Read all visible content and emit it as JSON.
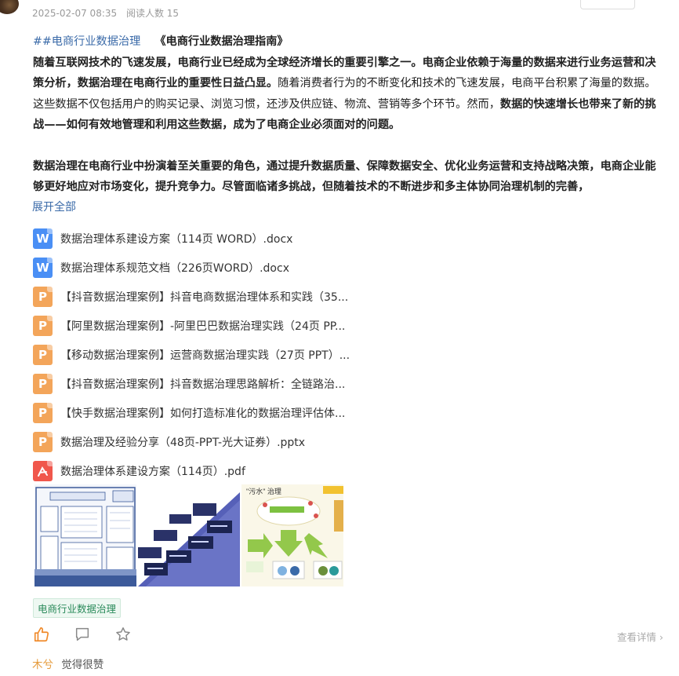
{
  "meta": {
    "date": "2025-02-07 08:35",
    "views": "阅读人数 15"
  },
  "post": {
    "hashtag": "##电商行业数据治理",
    "guide_title": "《电商行业数据治理指南》",
    "p1_b1": "随着互联网技术的飞速发展，电商行业已经成为全球经济增长的重要引擎之一。电商企业依赖于海量的数据来进行业务运营和决策分析，数据治理在电商行业的重要性日益凸显。",
    "p1_n1": "随着消费者行为的不断变化和技术的飞速发展，电商平台积累了海量的数据。这些数据不仅包括用户的购买记录、浏览习惯，还涉及供应链、物流、营销等多个环节。然而，",
    "p1_b2": "数据的快速增长也带来了新的挑战——如何有效地管理和利用这些数据，成为了电商企业必须面对的问题。",
    "p2": "数据治理在电商行业中扮演着至关重要的角色，通过提升数据质量、保障数据安全、优化业务运营和支持战略决策，电商企业能够更好地应对市场变化，提升竞争力。尽管面临诸多挑战，但随着技术的不断进步和多主体协同治理机制的完善，"
  },
  "expand_label": "展开全部",
  "files": [
    {
      "type": "word",
      "glyph": "W",
      "name": "数据治理体系建设方案（114页 WORD）.docx"
    },
    {
      "type": "word",
      "glyph": "W",
      "name": "数据治理体系规范文档（226页WORD）.docx"
    },
    {
      "type": "ppt",
      "glyph": "P",
      "name": "【抖音数据治理案例】抖音电商数据治理体系和实践（35..."
    },
    {
      "type": "ppt",
      "glyph": "P",
      "name": "【阿里数据治理案例】-阿里巴巴数据治理实践（24页 PP..."
    },
    {
      "type": "ppt",
      "glyph": "P",
      "name": "【移动数据治理案例】运营商数据治理实践（27页 PPT）..."
    },
    {
      "type": "ppt",
      "glyph": "P",
      "name": "【抖音数据治理案例】抖音数据治理思路解析：全链路治..."
    },
    {
      "type": "ppt",
      "glyph": "P",
      "name": "【快手数据治理案例】如何打造标准化的数据治理评估体..."
    },
    {
      "type": "ppt",
      "glyph": "P",
      "name": "数据治理及经验分享（48页-PPT-光大证券）.pptx"
    },
    {
      "type": "pdf",
      "glyph": "",
      "name": "数据治理体系建设方案（114页）.pdf"
    }
  ],
  "thumbs": {
    "t3_title": "\"污水\" 治理"
  },
  "tag": "电商行业数据治理",
  "actions": {
    "like": "thumb-up-icon",
    "comment": "comment-icon",
    "favorite": "star-icon"
  },
  "details_label": "查看详情 ›",
  "comment": {
    "user": "木兮",
    "text": "觉得很赞"
  },
  "colors": {
    "link": "#3a6aa8",
    "word": "#4a8ff5",
    "ppt": "#f3a55a",
    "pdf": "#f0574c",
    "tag": "#2a8a5a"
  }
}
